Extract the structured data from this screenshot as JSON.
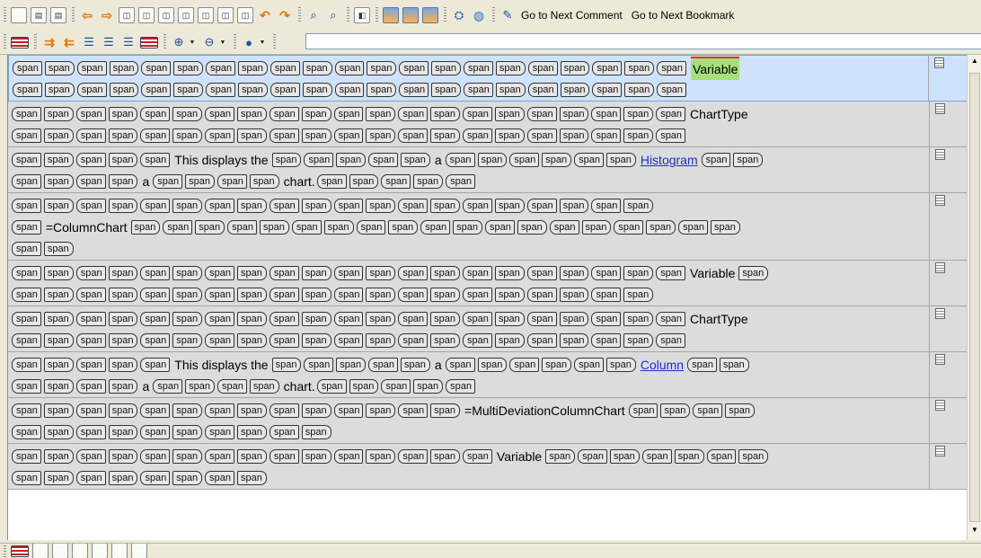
{
  "toolbar1": {
    "next_comment_label": "Go to Next Comment",
    "next_bookmark_label": "Go to Next Bookmark"
  },
  "tag_label": "span",
  "rows": [
    {
      "selected": true,
      "lines": [
        {
          "pre": 21,
          "text": "Variable",
          "style": "hl",
          "post": 0
        },
        {
          "pre": 21,
          "post": 0
        }
      ]
    },
    {
      "selected": false,
      "lines": [
        {
          "pre": 21,
          "text": "ChartType",
          "style": "",
          "post": 0
        },
        {
          "pre": 21,
          "post": 0
        }
      ]
    },
    {
      "selected": false,
      "lines": [
        {
          "pre": 5,
          "text": "This displays the",
          "style": "",
          "mid": [
            {
              "n": 5
            },
            {
              "t": "a"
            },
            {
              "n": 6
            },
            {
              "t": "Histogram",
              "style": "link"
            },
            {
              "n": 2
            }
          ]
        },
        {
          "pre": 4,
          "mid": [
            {
              "t": "a"
            },
            {
              "n": 4
            },
            {
              "t": "chart.",
              "style": "small"
            },
            {
              "n": 5
            }
          ]
        }
      ]
    },
    {
      "selected": false,
      "lines": [
        {
          "pre": 20,
          "post": 0
        },
        {
          "pre": 1,
          "text": "=ColumnChart",
          "style": "",
          "post": 19
        },
        {
          "pre": 2,
          "post": 0
        }
      ]
    },
    {
      "selected": false,
      "lines": [
        {
          "pre": 21,
          "text": "Variable",
          "style": "",
          "post": 1
        },
        {
          "pre": 20,
          "post": 0
        }
      ]
    },
    {
      "selected": false,
      "lines": [
        {
          "pre": 21,
          "text": "ChartType",
          "style": "",
          "post": 0
        },
        {
          "pre": 21,
          "post": 0
        }
      ]
    },
    {
      "selected": false,
      "lines": [
        {
          "pre": 5,
          "text": "This displays the",
          "style": "",
          "mid": [
            {
              "n": 5
            },
            {
              "t": "a"
            },
            {
              "n": 6
            },
            {
              "t": "Column",
              "style": "link"
            },
            {
              "n": 2
            }
          ]
        },
        {
          "pre": 4,
          "mid": [
            {
              "t": "a"
            },
            {
              "n": 4
            },
            {
              "t": "chart.",
              "style": "small"
            },
            {
              "n": 5
            }
          ]
        }
      ]
    },
    {
      "selected": false,
      "lines": [
        {
          "pre": 14,
          "text": "=MultiDeviationColumnChart",
          "style": "",
          "post": 4
        },
        {
          "pre": 10,
          "post": 0
        }
      ]
    },
    {
      "selected": false,
      "lines": [
        {
          "pre": 15,
          "text": "Variable",
          "style": "",
          "post": 7
        },
        {
          "pre": 8,
          "post": 0
        }
      ]
    }
  ]
}
